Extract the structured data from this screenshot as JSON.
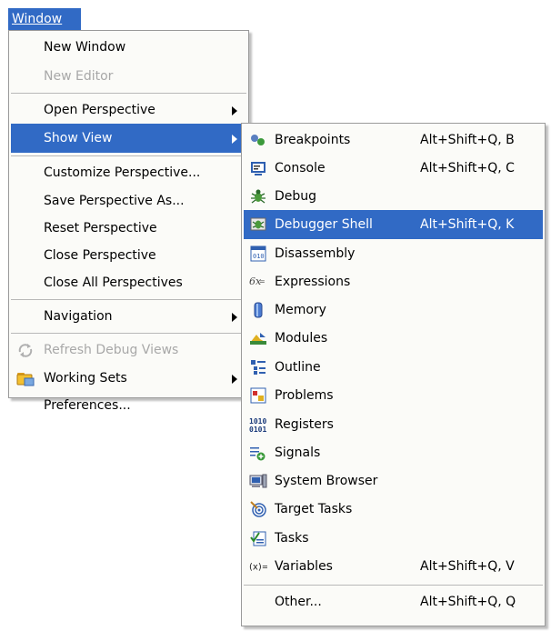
{
  "menubar": {
    "window_label": "Window"
  },
  "main_menu": {
    "items": [
      {
        "label": "New Window"
      },
      {
        "label": "New Editor"
      },
      {
        "label": "Open Perspective"
      },
      {
        "label": "Show View"
      },
      {
        "label": "Customize Perspective..."
      },
      {
        "label": "Save Perspective As..."
      },
      {
        "label": "Reset Perspective"
      },
      {
        "label": "Close Perspective"
      },
      {
        "label": "Close All Perspectives"
      },
      {
        "label": "Navigation"
      },
      {
        "label": "Refresh Debug Views"
      },
      {
        "label": "Working Sets"
      },
      {
        "label": "Preferences..."
      }
    ]
  },
  "show_view_menu": {
    "items": [
      {
        "label": "Breakpoints",
        "shortcut": "Alt+Shift+Q, B",
        "icon": "breakpoints-icon"
      },
      {
        "label": "Console",
        "shortcut": "Alt+Shift+Q, C",
        "icon": "console-icon"
      },
      {
        "label": "Debug",
        "icon": "debug-icon"
      },
      {
        "label": "Debugger Shell",
        "shortcut": "Alt+Shift+Q, K",
        "icon": "debugger-shell-icon"
      },
      {
        "label": "Disassembly",
        "icon": "disassembly-icon"
      },
      {
        "label": "Expressions",
        "icon": "expressions-icon"
      },
      {
        "label": "Memory",
        "icon": "memory-icon"
      },
      {
        "label": "Modules",
        "icon": "modules-icon"
      },
      {
        "label": "Outline",
        "icon": "outline-icon"
      },
      {
        "label": "Problems",
        "icon": "problems-icon"
      },
      {
        "label": "Registers",
        "icon": "registers-icon"
      },
      {
        "label": "Signals",
        "icon": "signals-icon"
      },
      {
        "label": "System Browser",
        "icon": "system-browser-icon"
      },
      {
        "label": "Target Tasks",
        "icon": "target-tasks-icon"
      },
      {
        "label": "Tasks",
        "icon": "tasks-icon"
      },
      {
        "label": "Variables",
        "shortcut": "Alt+Shift+Q, V",
        "icon": "variables-icon"
      },
      {
        "label": "Other...",
        "shortcut": "Alt+Shift+Q, Q"
      }
    ]
  },
  "colors": {
    "selection": "#316ac5",
    "menu_bg": "#fbfbf8",
    "disabled_text": "#a8a8a8"
  }
}
